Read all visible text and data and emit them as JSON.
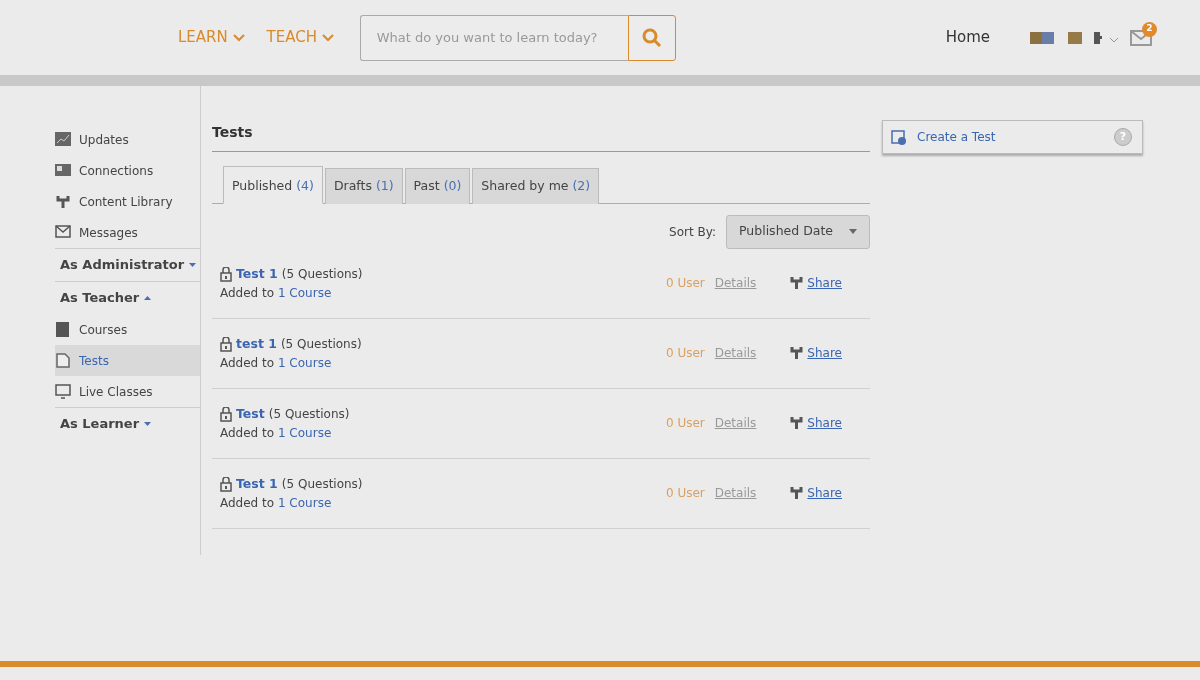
{
  "header": {
    "nav": [
      {
        "label": "LEARN"
      },
      {
        "label": "TEACH"
      }
    ],
    "search": {
      "placeholder": "What do you want to learn today?"
    },
    "home": "Home",
    "mail_badge": "2"
  },
  "sidebar": {
    "items": [
      {
        "kind": "link",
        "label": "Updates",
        "selected": false
      },
      {
        "kind": "link",
        "label": "Connections",
        "selected": false
      },
      {
        "kind": "link",
        "label": "Content Library",
        "selected": false
      },
      {
        "kind": "link",
        "label": "Messages",
        "selected": false
      },
      {
        "kind": "section",
        "label": "As Administrator",
        "expanded": false
      },
      {
        "kind": "section",
        "label": "As Teacher",
        "expanded": true
      },
      {
        "kind": "link",
        "label": "Courses",
        "selected": false
      },
      {
        "kind": "link",
        "label": "Tests",
        "selected": true
      },
      {
        "kind": "link",
        "label": "Live Classes",
        "selected": false
      },
      {
        "kind": "section",
        "label": "As Learner",
        "expanded": false
      }
    ]
  },
  "main": {
    "title": "Tests",
    "tabs": [
      {
        "label": "Published",
        "count": "(4)",
        "selected": true
      },
      {
        "label": "Drafts",
        "count": "(1)",
        "selected": false
      },
      {
        "label": "Past",
        "count": "(0)",
        "selected": false
      },
      {
        "label": "Shared by me",
        "count": "(2)",
        "selected": false
      }
    ],
    "sort_label": "Sort By:",
    "sort_value": "Published Date",
    "rows": [
      {
        "name": "Test 1",
        "questions": "(5 Questions)",
        "added_to": "Added to",
        "course": "1 Course",
        "users": "0 User",
        "details": "Details",
        "share": "Share"
      },
      {
        "name": "test 1",
        "questions": "(5 Questions)",
        "added_to": "Added to",
        "course": "1 Course",
        "users": "0 User",
        "details": "Details",
        "share": "Share"
      },
      {
        "name": "Test",
        "questions": "(5 Questions)",
        "added_to": "Added to",
        "course": "1 Course",
        "users": "0 User",
        "details": "Details",
        "share": "Share"
      },
      {
        "name": "Test 1",
        "questions": "(5 Questions)",
        "added_to": "Added to",
        "course": "1 Course",
        "users": "0 User",
        "details": "Details",
        "share": "Share"
      }
    ]
  },
  "aside": {
    "create_label": "Create a Test",
    "help": "?"
  }
}
